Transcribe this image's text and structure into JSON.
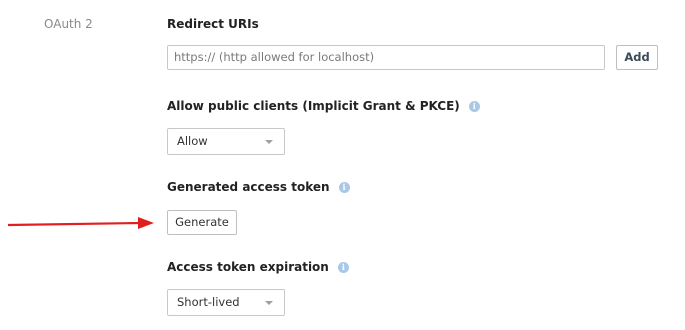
{
  "section": {
    "label": "OAuth 2"
  },
  "redirect_uris": {
    "heading": "Redirect URIs",
    "placeholder": "https:// (http allowed for localhost)",
    "add_label": "Add"
  },
  "public_clients": {
    "heading": "Allow public clients (Implicit Grant & PKCE)",
    "selected": "Allow"
  },
  "access_token": {
    "heading": "Generated access token",
    "generate_label": "Generate"
  },
  "token_expiration": {
    "heading": "Access token expiration",
    "selected": "Short-lived"
  },
  "colors": {
    "annotation_arrow": "#e02020",
    "info_icon": "#a9c8e8"
  },
  "icons": {
    "info": "info-icon",
    "dropdown": "chevron-down-icon",
    "annotation": "red-arrow-annotation"
  }
}
